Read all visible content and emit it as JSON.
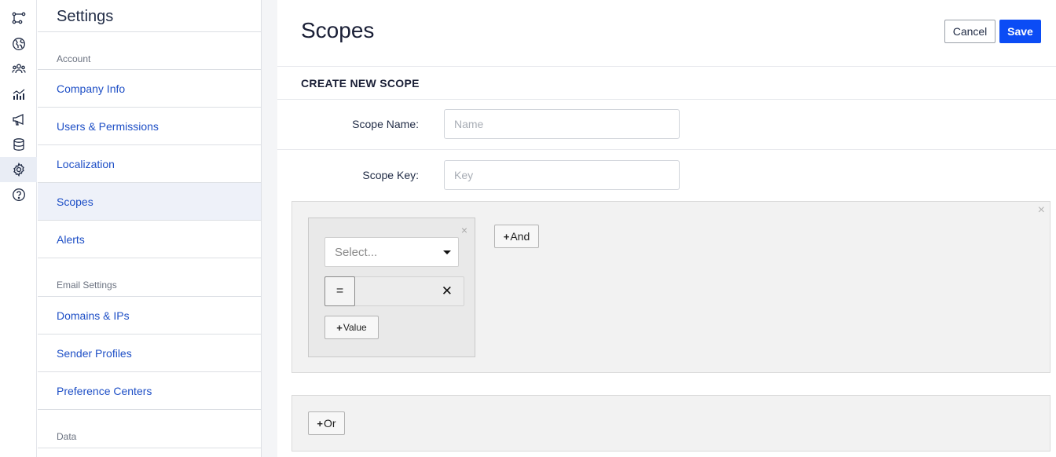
{
  "rail": {
    "items": [
      {
        "icon": "flow-icon"
      },
      {
        "icon": "globe-icon"
      },
      {
        "icon": "users-icon"
      },
      {
        "icon": "analytics-icon"
      },
      {
        "icon": "megaphone-icon"
      },
      {
        "icon": "database-icon"
      },
      {
        "icon": "gear-icon",
        "active": true
      },
      {
        "icon": "help-icon"
      }
    ]
  },
  "nav": {
    "title": "Settings",
    "sections": [
      {
        "label": "Account",
        "items": [
          "Company Info",
          "Users & Permissions",
          "Localization",
          "Scopes",
          "Alerts"
        ]
      },
      {
        "label": "Email Settings",
        "items": [
          "Domains & IPs",
          "Sender Profiles",
          "Preference Centers"
        ]
      },
      {
        "label": "Data",
        "items": []
      }
    ],
    "active_item": "Scopes"
  },
  "header": {
    "title": "Scopes",
    "cancel_label": "Cancel",
    "save_label": "Save"
  },
  "form": {
    "section_title": "CREATE NEW SCOPE",
    "scope_name": {
      "label": "Scope Name:",
      "value": "",
      "placeholder": "Name"
    },
    "scope_key": {
      "label": "Scope Key:",
      "value": "",
      "placeholder": "Key"
    }
  },
  "builder": {
    "group_close": "×",
    "condition_close": "×",
    "select_placeholder": "Select...",
    "operator": "=",
    "clear_symbol": "✕",
    "value_button": "Value",
    "and_button": "And",
    "or_button": "Or",
    "plus_symbol": "+"
  },
  "colors": {
    "accent": "#0b4cf5",
    "link": "#1e4fc6",
    "active_nav_bg": "#eef1f9"
  }
}
